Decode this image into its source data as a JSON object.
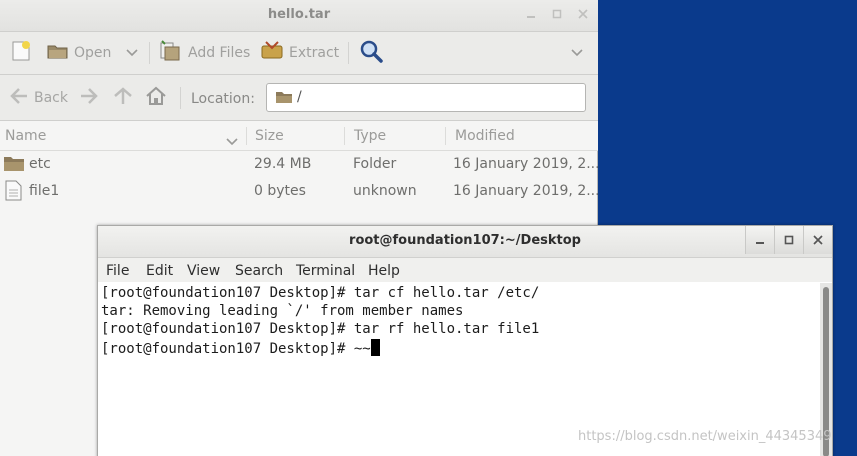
{
  "archive_window": {
    "title": "hello.tar",
    "toolbar": {
      "open_label": "Open",
      "add_files_label": "Add Files",
      "extract_label": "Extract"
    },
    "location": {
      "back_label": "Back",
      "location_label": "Location:",
      "path": "/"
    },
    "columns": {
      "name": "Name",
      "size": "Size",
      "type": "Type",
      "modified": "Modified"
    },
    "rows": [
      {
        "name": "etc",
        "size": "29.4 MB",
        "type": "Folder",
        "modified": "16 January 2019, 2..."
      },
      {
        "name": "file1",
        "size": "0 bytes",
        "type": "unknown",
        "modified": "16 January 2019, 2..."
      }
    ]
  },
  "terminal_window": {
    "title": "root@foundation107:~/Desktop",
    "menu": {
      "file": "File",
      "edit": "Edit",
      "view": "View",
      "search": "Search",
      "terminal": "Terminal",
      "help": "Help"
    },
    "lines": [
      "[root@foundation107 Desktop]# tar cf hello.tar /etc/",
      "tar: Removing leading `/' from member names",
      "[root@foundation107 Desktop]# tar rf hello.tar file1",
      "[root@foundation107 Desktop]# ~~"
    ]
  },
  "watermark": "https://blog.csdn.net/weixin_44345349",
  "colors": {
    "desktop": "#0a3a8c",
    "folder": "#8c7a5a"
  }
}
